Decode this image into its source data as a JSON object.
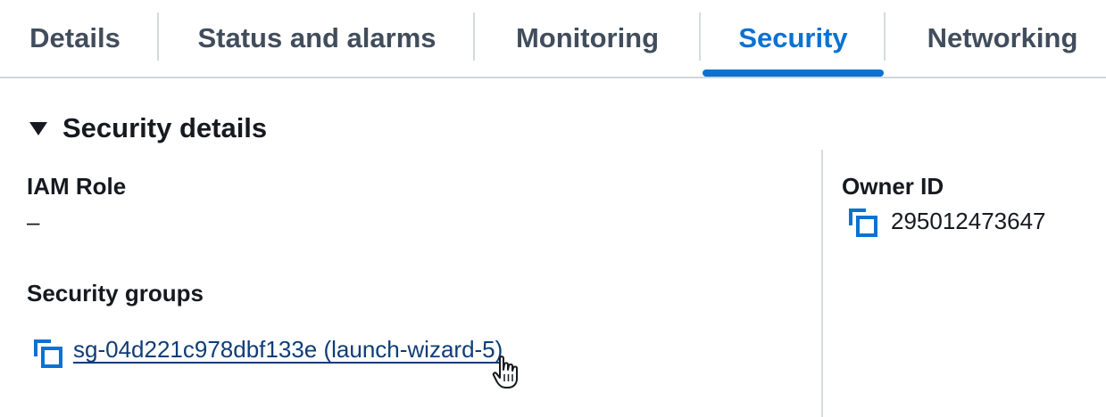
{
  "tabs": [
    {
      "label": "Details",
      "active": false
    },
    {
      "label": "Status and alarms",
      "active": false
    },
    {
      "label": "Monitoring",
      "active": false
    },
    {
      "label": "Security",
      "active": true
    },
    {
      "label": "Networking",
      "active": false
    }
  ],
  "section": {
    "title": "Security details",
    "expanded": true,
    "toggle_icon": "caret-down-icon"
  },
  "iam_role": {
    "label": "IAM Role",
    "value": "–"
  },
  "security_groups": {
    "label": "Security groups",
    "link_text": "sg-04d221c978dbf133e (launch-wizard-5)",
    "copy_icon": "copy-icon"
  },
  "owner": {
    "label": "Owner ID",
    "value": "295012473647",
    "copy_icon": "copy-icon"
  },
  "cursor": {
    "icon": "pointer-hand-icon"
  },
  "colors": {
    "accent": "#0972d3",
    "link": "#0f3d77",
    "tab_text": "#414d5c",
    "text": "#16191f",
    "divider": "#d5dbdb"
  }
}
